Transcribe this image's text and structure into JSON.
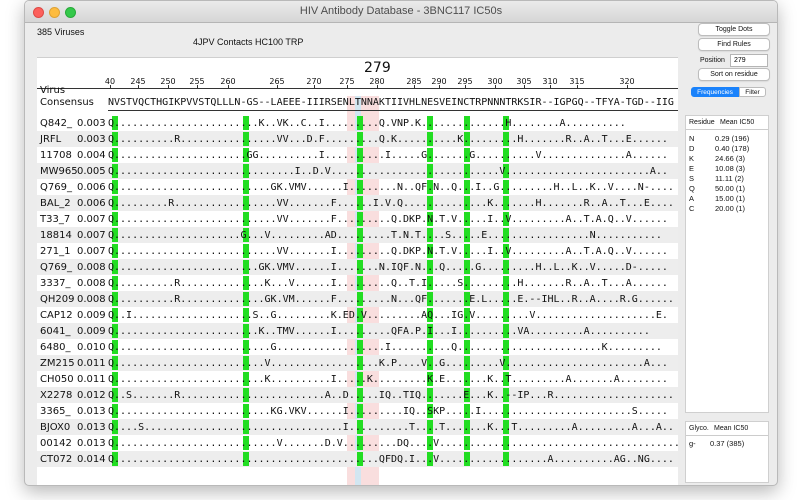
{
  "window": {
    "title": "HIV Antibody Database - 3BNC117 IC50s"
  },
  "virus_count": "385 Viruses",
  "contacts_label": "4JPV Contacts HC100  TRP",
  "position_marker": "279",
  "ruler_ticks": [
    "40",
    "245",
    "250",
    "255",
    "260",
    "265",
    "270",
    "275",
    "280",
    "285",
    "290",
    "295",
    "300",
    "305",
    "310",
    "315",
    "320"
  ],
  "headers": {
    "virus": "Virus",
    "consensus": "Consensus"
  },
  "consensus_seq": "NVSTVQCTHGIKPVVSTQLLLN-GS--LAEEE-IIIRSENLTNNAKTIIVHLNESVEINCTRPNNNTRKSIR--IGPGQ--TFYA-TGD--IIG",
  "rows": [
    {
      "name": "Q842_",
      "value": "0.003",
      "seq": "Q........................K..VK..C..I.........Q.VNP.K..............H........A.........."
    },
    {
      "name": "JRFL",
      "value": "0.003",
      "seq": "Q..........R................VV...D.F.........Q.K..........K.........H.......R..A..T...E......"
    },
    {
      "name": "11708",
      "value": "0.004",
      "seq": "Q......................GG..........I..........I.....G.......G..........V..............A......"
    },
    {
      "name": "MW965",
      "value": "0.005",
      "seq": "Q..............................I..D.V............................V........................A.."
    },
    {
      "name": "Q769_",
      "value": "0.006",
      "seq": "Q..........................GK.VMV......I........N..QF.N..Q...I..G.........H..L..K..V....N-...."
    },
    {
      "name": "BAL_2",
      "value": "0.006",
      "seq": "Q.........R.................VV.......F......I.V.Q..............K.......H.......R..A..T...E...."
    },
    {
      "name": "T33_7",
      "value": "0.007",
      "seq": "Q...........................VV.......F.........Q.DKP.N.T.V.....I..V.........A..T.A.Q..V......"
    },
    {
      "name": "18814",
      "value": "0.007",
      "seq": "Q.....................G...V.........AD.........T.N.T....S.....E.................N..........."
    },
    {
      "name": "271_1",
      "value": "0.007",
      "seq": "Q...........................VV.......I.........Q.DKP.N.T.V.....I..V.........A..T.A.Q..V......"
    },
    {
      "name": "Q769_",
      "value": "0.008",
      "seq": "Q........................GK.VMV......I.......N.IQF.N...Q.....G.........H..L..K..V.....D-....."
    },
    {
      "name": "3337_",
      "value": "0.008",
      "seq": "Q..........R..............K...V......I.........Q..T.I.....S.........H.......R..A..T...A......"
    },
    {
      "name": "QH209",
      "value": "0.008",
      "seq": "Q..........R..............GK.VM......F.........N...QF.......E.L.....E.--IHL..R..A....R.G......"
    },
    {
      "name": "CAP12",
      "value": "0.009",
      "seq": "Q..I....................S..G.........K.ED.V.........AQ...IG.V.........V....................E."
    },
    {
      "name": "6041_",
      "value": "0.009",
      "seq": "Q........................K..TMV......I.........QFA.P.I...I..........VA.........A.........."
    },
    {
      "name": "6480_",
      "value": "0.010",
      "seq": "Q..........................G..................I..........Q........................K........."
    },
    {
      "name": "ZM215",
      "value": "0.011",
      "seq": "Q.........................V..................K.P....V..G.........V.......................A..."
    },
    {
      "name": "CH050",
      "value": "0.011",
      "seq": "Q.........................K..........I.....K.........K.E.......K..T.........A.......A........"
    },
    {
      "name": "X2278",
      "value": "0.012",
      "seq": "Q..S.......R........................A..D.....IQ..TIQ.......E...K..--IP...R...................."
    },
    {
      "name": "3365_",
      "value": "0.013",
      "seq": "Q..........................KG.VKV......I.........IQ..SKP.....I.........................S....."
    },
    {
      "name": "BJOX0",
      "value": "0.013",
      "seq": "Q....S.................................I..........T....T.......K...T.........A.........A...A.."
    },
    {
      "name": "00142",
      "value": "0.013",
      "seq": "Q...........................V.......D.V.........DQ....V........................................"
    },
    {
      "name": "CT072",
      "value": "0.014",
      "seq": "Q............................................QFDQ.I...V..................A..........AG..NG...."
    }
  ],
  "buttons": {
    "toggle_dots": "Toggle Dots",
    "find_rules": "Find Rules",
    "sort_on_residue": "Sort on residue"
  },
  "position": {
    "label": "Position",
    "value": "279"
  },
  "tabs": {
    "frequencies": "Frequencies",
    "filter": "Filter"
  },
  "freq_table": {
    "col_residue": "Residue",
    "col_mean": "Mean IC50",
    "rows": [
      {
        "res": "N",
        "val": "0.29 (196)"
      },
      {
        "res": "D",
        "val": "0.40 (178)"
      },
      {
        "res": "K",
        "val": "24.66 (3)"
      },
      {
        "res": "E",
        "val": "10.08 (3)"
      },
      {
        "res": "S",
        "val": "11.11 (2)"
      },
      {
        "res": "Q",
        "val": "50.00 (1)"
      },
      {
        "res": "A",
        "val": "15.00 (1)"
      },
      {
        "res": "C",
        "val": "20.00 (1)"
      }
    ]
  },
  "glyco_table": {
    "col_glyco": "Glyco.",
    "col_mean": "Mean IC50",
    "rows": [
      {
        "res": "g-",
        "val": "0.37 (385)"
      }
    ]
  },
  "colors": {
    "highlight_green": "#22dd22",
    "highlight_pink": "#f9dede",
    "highlight_blue": "#d2e6f1",
    "tab_active": "#1a82fb"
  }
}
